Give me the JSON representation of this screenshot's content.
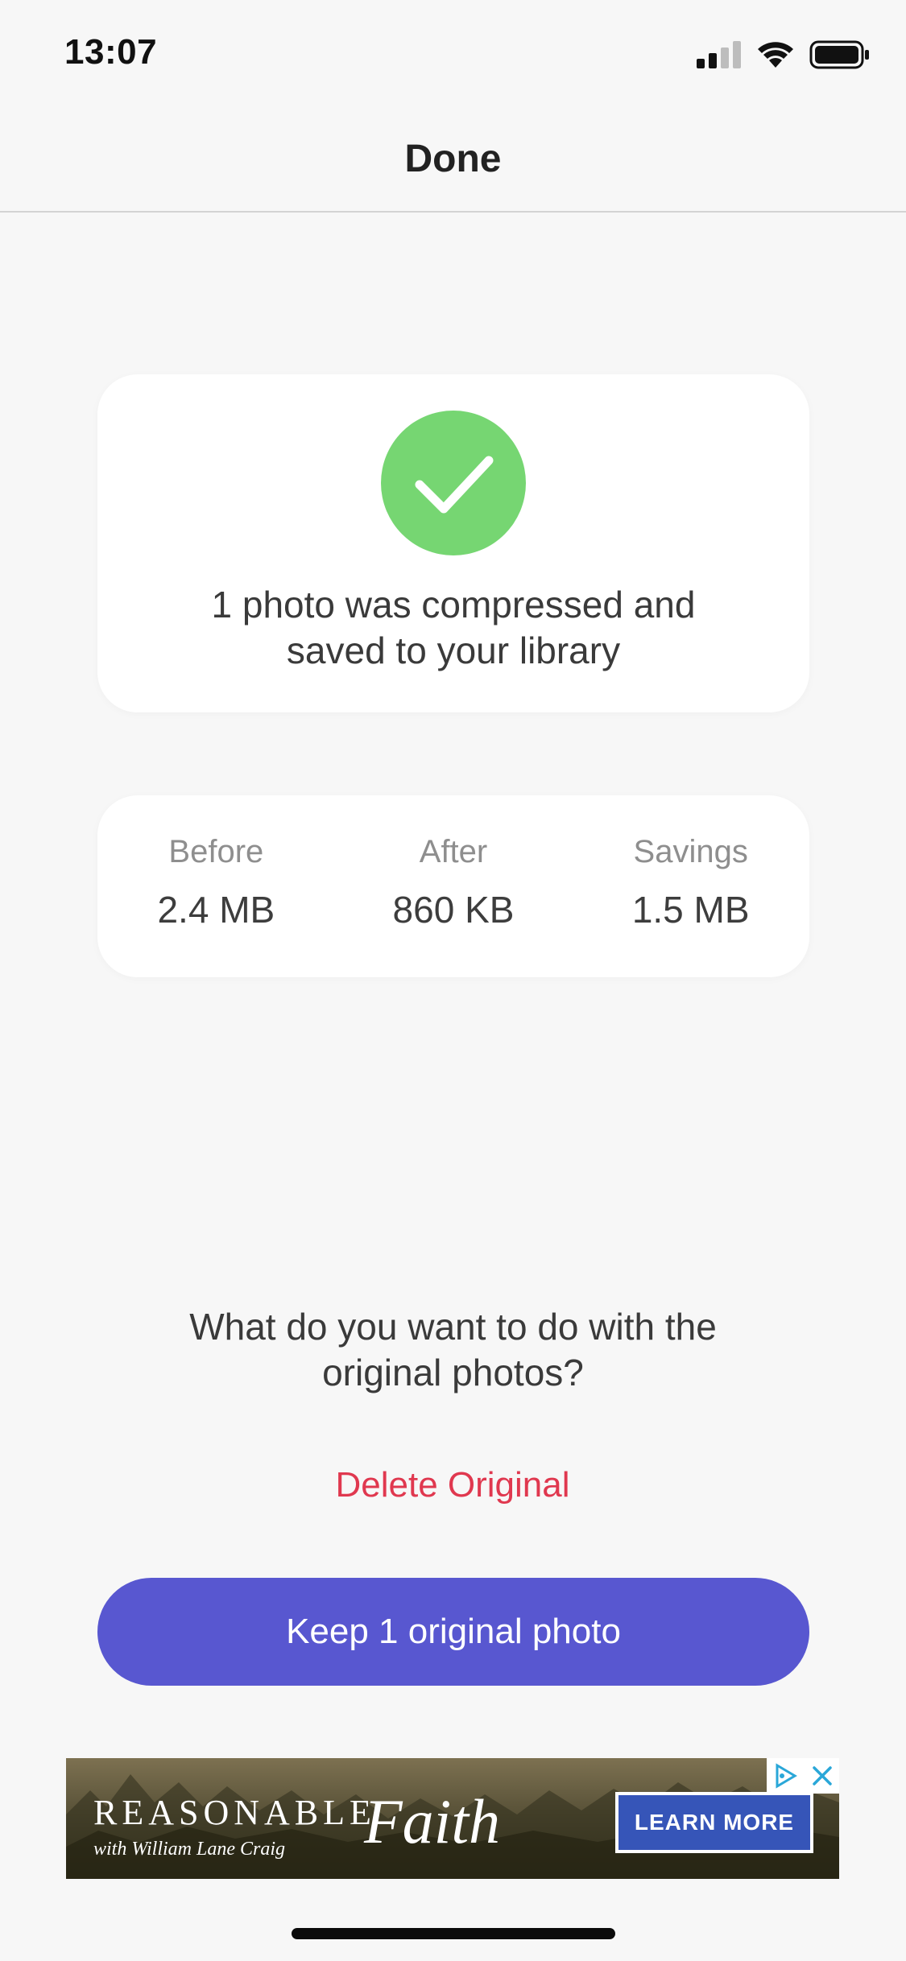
{
  "status_bar": {
    "time": "13:07"
  },
  "nav": {
    "title": "Done"
  },
  "success_card": {
    "icon": "checkmark-icon",
    "message": "1 photo was compressed and\nsaved to your library",
    "icon_color": "#76d672"
  },
  "stats": [
    {
      "label": "Before",
      "value": "2.4 MB"
    },
    {
      "label": "After",
      "value": "860 KB"
    },
    {
      "label": "Savings",
      "value": "1.5 MB"
    }
  ],
  "question": "What do you want to do with the\noriginal photos?",
  "delete_label": "Delete Original",
  "keep_label": "Keep 1 original photo",
  "colors": {
    "accent": "#5857d0",
    "destructive": "#e0384f",
    "success": "#76d672",
    "background": "#f7f7f7"
  },
  "ad": {
    "brand": "REASONABLE",
    "subline": "with William Lane Craig",
    "script": "Faith",
    "cta": "LEARN MORE"
  }
}
